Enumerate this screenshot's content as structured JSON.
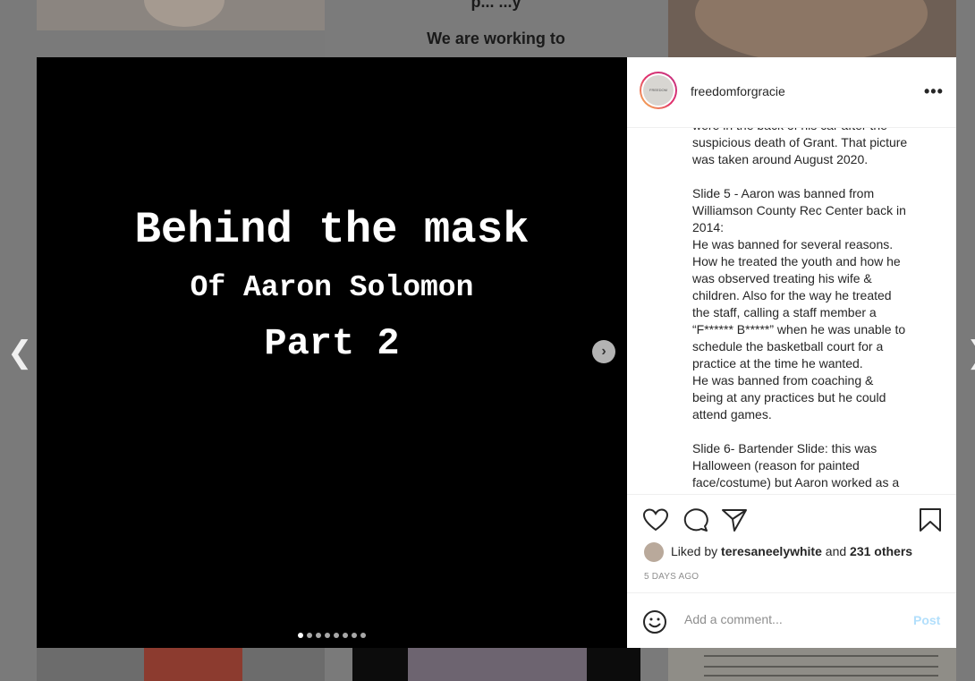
{
  "background": {
    "tile_text_top": "We are working to",
    "tile_text_cut": "p...                    ...y"
  },
  "post": {
    "username": "freedomforgracie",
    "avatar_text": "FREEDOM",
    "media": {
      "title": "Behind the mask",
      "subtitle": "Of Aaron Solomon",
      "part": "Part 2",
      "slide_count": 8,
      "active_slide": 1
    },
    "caption_lines": [
      "were in the back of his car after the",
      "suspicious death of Grant. That picture",
      "was taken around August 2020.",
      "",
      "Slide 5 - Aaron was banned from",
      "Williamson County Rec Center back in",
      "2014:",
      "He was banned for several reasons.",
      "How he treated the youth and how he",
      "was observed treating his wife &",
      "children. Also for the way he treated",
      "the staff, calling a staff member a",
      "“F****** B*****” when he was unable to",
      "schedule the basketball court for a",
      "practice at the time he wanted.",
      "He was banned from coaching &",
      "being at any practices but he could",
      "attend games.",
      "",
      "Slide 6- Bartender Slide: this was",
      "Halloween (reason for painted",
      "face/costume) but Aaron worked as a"
    ],
    "likes": {
      "prefix": "Liked by",
      "user": "teresaneelywhite",
      "joiner": "and",
      "others": "231 others"
    },
    "timestamp": "5 DAYS AGO",
    "comment": {
      "placeholder": "Add a comment...",
      "post_label": "Post"
    }
  },
  "colors": {
    "post_button": "#b2dffc",
    "overlay": "#7a7a7a"
  }
}
